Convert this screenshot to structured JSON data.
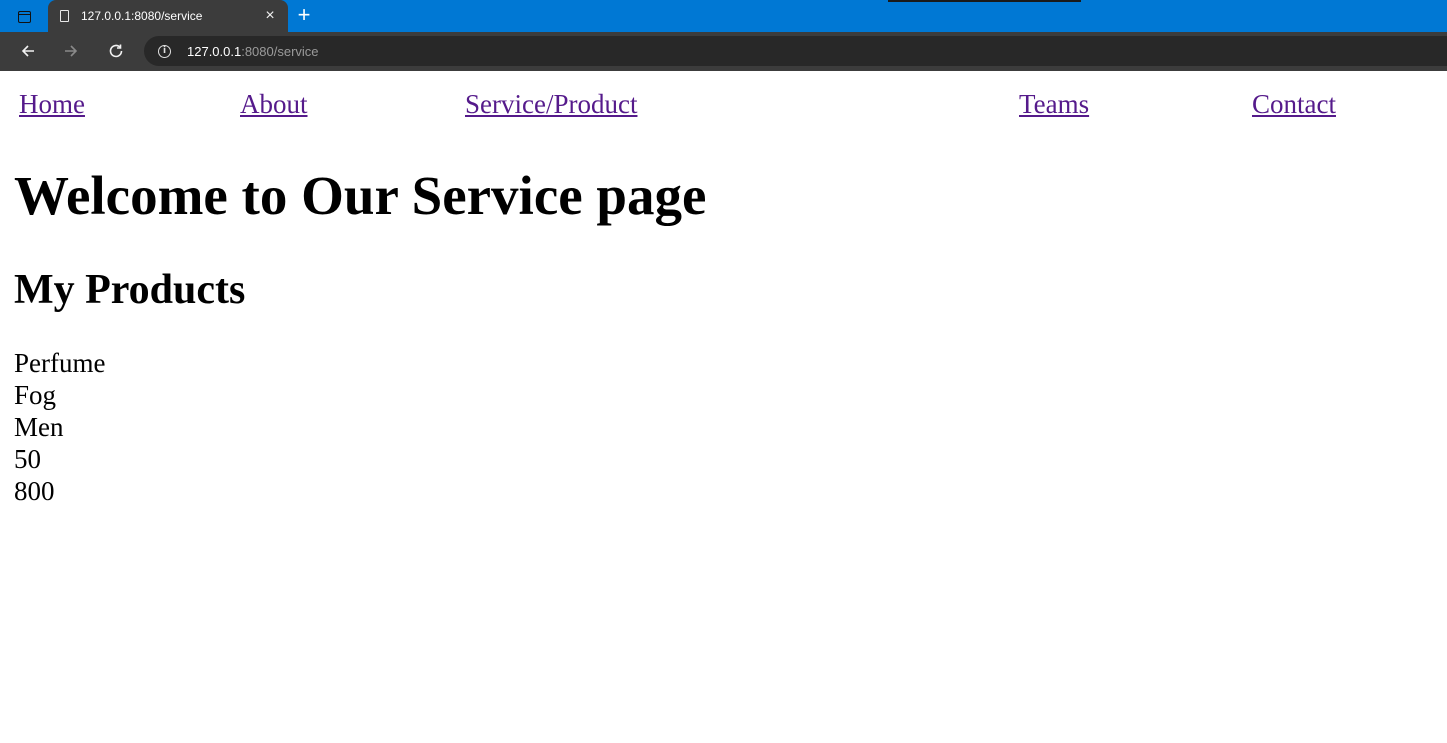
{
  "browser": {
    "tab_title": "127.0.0.1:8080/service",
    "tab_close_glyph": "×",
    "new_tab_glyph": "+",
    "address": {
      "host": "127.0.0.1",
      "rest": ":8080/service"
    },
    "icons": {
      "window_menu": "window-menu-icon",
      "page": "page-icon",
      "back": "back-arrow-icon",
      "forward": "forward-arrow-icon",
      "reload": "reload-icon",
      "info": "info-icon"
    },
    "colors": {
      "tabstrip": "#0078d4",
      "toolbar": "#3c3c3c",
      "omnibox": "#282828"
    }
  },
  "nav": {
    "home": "Home",
    "about": "About",
    "service": "Service/Product",
    "teams": "Teams",
    "contact": "Contact",
    "link_color": "#551a8b"
  },
  "page": {
    "heading": "Welcome to Our Service page",
    "subheading": "My Products"
  },
  "products": [
    "Perfume",
    "Fog",
    "Men",
    "50",
    "800"
  ]
}
